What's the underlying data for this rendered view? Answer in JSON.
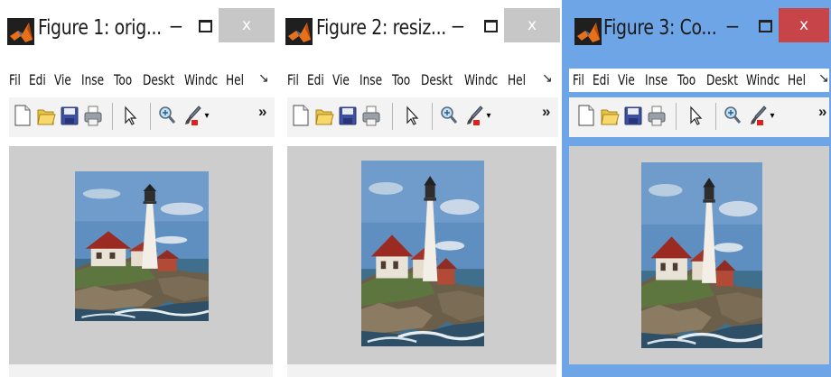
{
  "windows": [
    {
      "title": "Figure 1: orig...",
      "minimize": "−",
      "close": "x",
      "menu": [
        "Fil",
        "Edi",
        "Vie",
        "Inse",
        "Too",
        "Deskt",
        "Windc",
        "Hel"
      ],
      "menu_more": "↘",
      "toolbar_more": "»",
      "active": false
    },
    {
      "title": "Figure 2: resiz...",
      "minimize": "−",
      "close": "x",
      "menu": [
        "Fil",
        "Edi",
        "Vie",
        "Inse",
        "Too",
        "Deskt",
        "Windc",
        "Hel"
      ],
      "menu_more": "↘",
      "toolbar_more": "»",
      "active": false
    },
    {
      "title": "Figure 3: Co...",
      "minimize": "−",
      "close": "x",
      "menu": [
        "Fil",
        "Edi",
        "Vie",
        "Inse",
        "Too",
        "Deskt",
        "Windc",
        "Hel"
      ],
      "menu_more": "↘",
      "toolbar_more": "»",
      "active": true
    }
  ],
  "toolbar_icons": [
    "new-figure-icon",
    "open-file-icon",
    "save-icon",
    "print-icon",
    "edit-plot-arrow-icon",
    "zoom-in-icon",
    "brush-icon",
    "dropdown-arrow-icon"
  ],
  "colors": {
    "active_border": "#6ea5e6",
    "close_active": "#c74449",
    "close_inactive": "#c7c7c7",
    "axes_background": "#cdcdcd",
    "matlab_orange": "#e8701a"
  }
}
